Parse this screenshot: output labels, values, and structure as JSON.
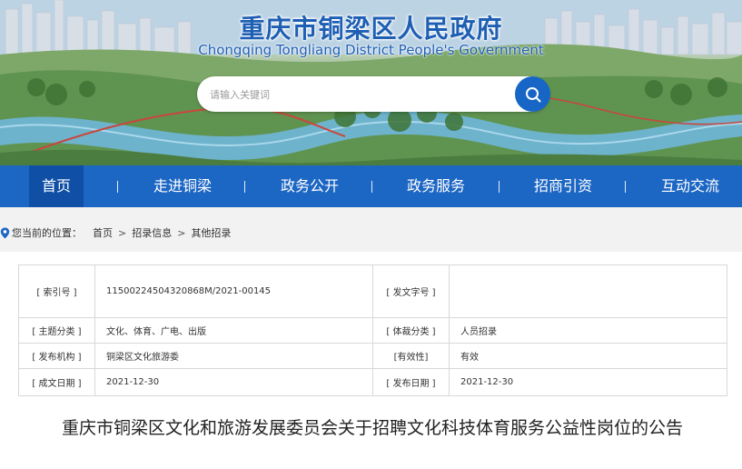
{
  "site": {
    "title": "重庆市铜梁区人民政府",
    "subtitle": "Chongqing Tongliang District People's Government"
  },
  "search": {
    "placeholder": "请输入关键词",
    "button_icon": "search-icon"
  },
  "nav": {
    "items": [
      {
        "label": "首页",
        "active": true
      },
      {
        "label": "走进铜梁"
      },
      {
        "label": "政务公开"
      },
      {
        "label": "政务服务"
      },
      {
        "label": "招商引资"
      },
      {
        "label": "互动交流"
      }
    ]
  },
  "breadcrumb": {
    "prefix": "您当前的位置：",
    "items": [
      "首页",
      "招录信息",
      "其他招录"
    ],
    "separator": ">"
  },
  "info": {
    "rows": [
      {
        "l1": "[ 索引号 ]",
        "v1": "11500224504320868M/2021-00145",
        "l2": "[ 发文字号 ]",
        "v2": ""
      },
      {
        "l1": "[ 主题分类 ]",
        "v1": "文化、体育、广电、出版",
        "l2": "[ 体裁分类 ]",
        "v2": "人员招录"
      },
      {
        "l1": "[ 发布机构 ]",
        "v1": "铜梁区文化旅游委",
        "l2": "[有效性]",
        "v2": "有效"
      },
      {
        "l1": "[ 成文日期 ]",
        "v1": "2021-12-30",
        "l2": "[ 发布日期 ]",
        "v2": "2021-12-30"
      }
    ]
  },
  "article": {
    "title": "重庆市铜梁区文化和旅游发展委员会关于招聘文化科技体育服务公益性岗位的公告"
  },
  "colors": {
    "brand_blue": "#1c66c4",
    "nav_active": "#0f4fa6",
    "breadcrumb_bg": "#f2f2f2"
  }
}
